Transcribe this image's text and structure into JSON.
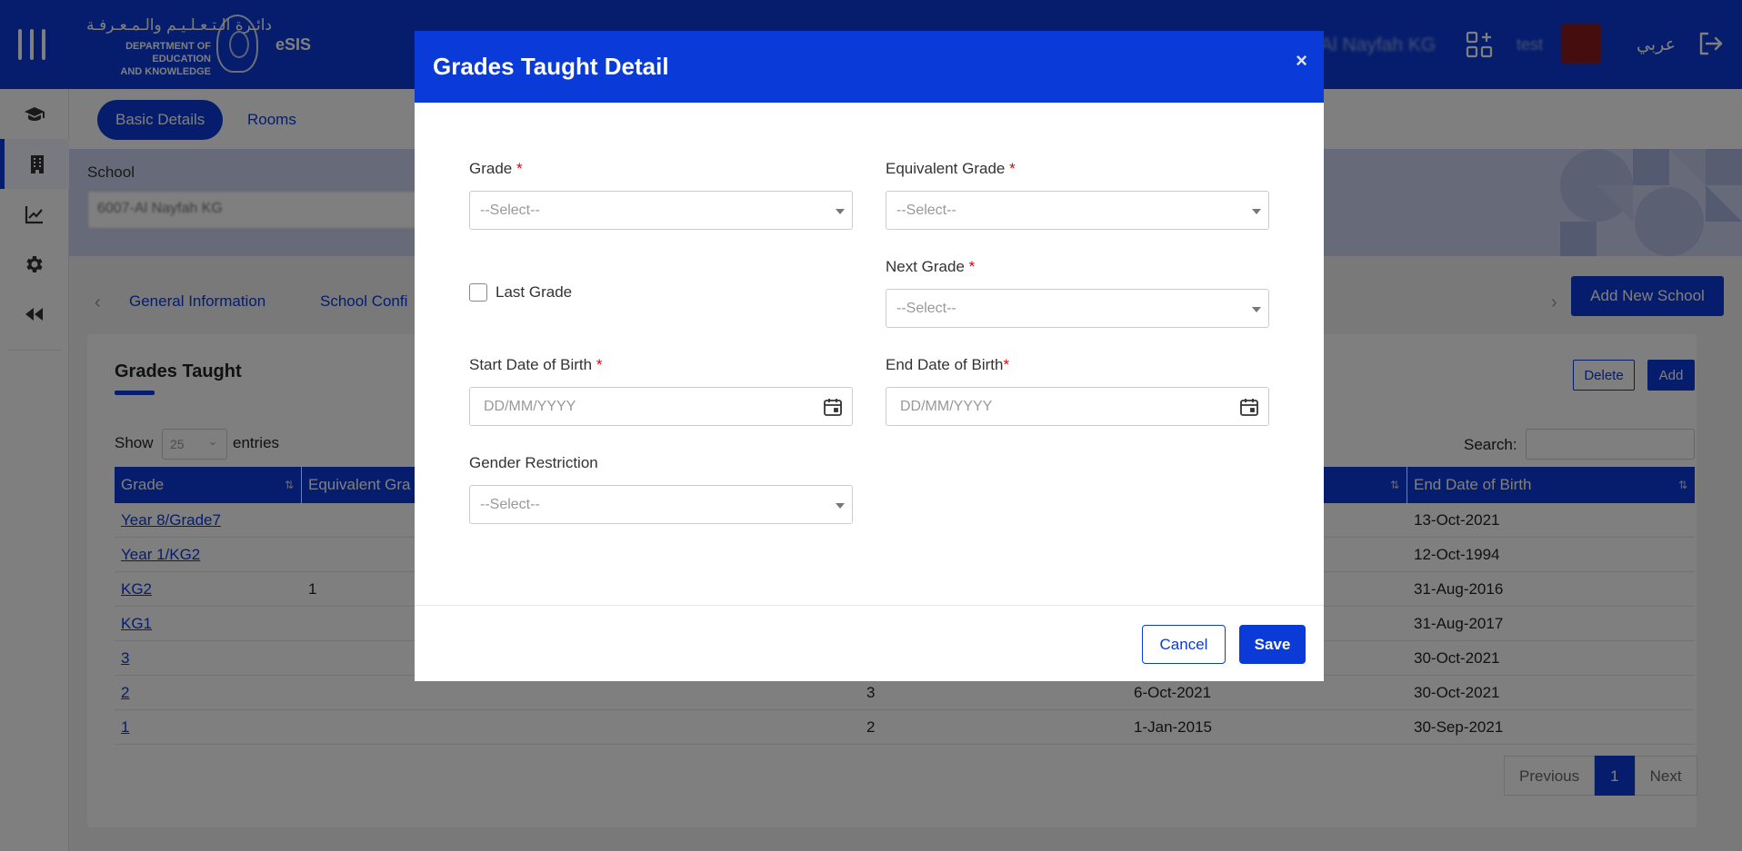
{
  "header": {
    "logo_ar": "دائـرة الـتـعـلـيـم والـمـعـرفـة",
    "logo_en_line1": "DEPARTMENT OF EDUCATION",
    "logo_en_line2": "AND KNOWLEDGE",
    "brand": "eSIS",
    "school_name": "Al Nayfah KG",
    "user_name": "test",
    "lang_link": "عربي",
    "icons": [
      "hamburger-icon",
      "apps-add-icon",
      "logout-icon"
    ]
  },
  "sidebar": {
    "items": [
      {
        "name": "graduation-cap-icon"
      },
      {
        "name": "building-icon",
        "active": true
      },
      {
        "name": "chart-line-icon"
      },
      {
        "name": "gear-icon"
      },
      {
        "name": "double-chevron-left-icon"
      }
    ]
  },
  "subtabs": [
    {
      "label": "Basic Details",
      "active": true
    },
    {
      "label": "Rooms",
      "active": false
    }
  ],
  "school": {
    "label": "School",
    "value": "6007-Al Nayfah KG"
  },
  "nav": {
    "prev_arrow": "‹",
    "next_arrow": "›",
    "links": [
      "General Information",
      "School Confi"
    ],
    "add_new_school": "Add New School"
  },
  "grades_card": {
    "title": "Grades Taught",
    "delete_label": "Delete",
    "add_label": "Add",
    "show_label": "Show",
    "entries_value": "25",
    "entries_label": "entries",
    "search_label": "Search:",
    "columns": [
      "Grade",
      "Equivalent Gra",
      "",
      "",
      "End Date of Birth"
    ],
    "rows": [
      {
        "grade": "Year 8/Grade7",
        "equiv": "",
        "next": "",
        "start": "",
        "end": "13-Oct-2021"
      },
      {
        "grade": "Year 1/KG2",
        "equiv": "",
        "next": "",
        "start": "",
        "end": "12-Oct-1994"
      },
      {
        "grade": "KG2",
        "equiv": "1",
        "next": "",
        "start": "",
        "end": "31-Aug-2016"
      },
      {
        "grade": "KG1",
        "equiv": "",
        "next": "",
        "start": "",
        "end": "31-Aug-2017"
      },
      {
        "grade": "3",
        "equiv": "",
        "next": "",
        "start": "",
        "end": "30-Oct-2021"
      },
      {
        "grade": "2",
        "equiv": "",
        "next": "3",
        "start": "6-Oct-2021",
        "end": "30-Oct-2021"
      },
      {
        "grade": "1",
        "equiv": "",
        "next": "2",
        "start": "1-Jan-2015",
        "end": "30-Sep-2021"
      }
    ],
    "pager": {
      "previous": "Previous",
      "current": "1",
      "next": "Next"
    }
  },
  "modal": {
    "title": "Grades Taught Detail",
    "close": "×",
    "req_mark": "*",
    "grade_label": "Grade",
    "grade_placeholder": "--Select--",
    "equiv_label": "Equivalent Grade",
    "equiv_placeholder": "--Select--",
    "last_grade_label": "Last Grade",
    "next_grade_label": "Next Grade",
    "next_grade_placeholder": "--Select--",
    "start_dob_label": "Start Date of Birth",
    "start_dob_placeholder": "DD/MM/YYYY",
    "end_dob_label": "End Date of Birth",
    "end_dob_placeholder": "DD/MM/YYYY",
    "gender_label": "Gender Restriction",
    "gender_placeholder": "--Select--",
    "cancel_label": "Cancel",
    "save_label": "Save"
  },
  "colors": {
    "primary": "#0a3bd8",
    "required": "#e00000",
    "overlay": "rgba(0,0,0,0.5)"
  }
}
